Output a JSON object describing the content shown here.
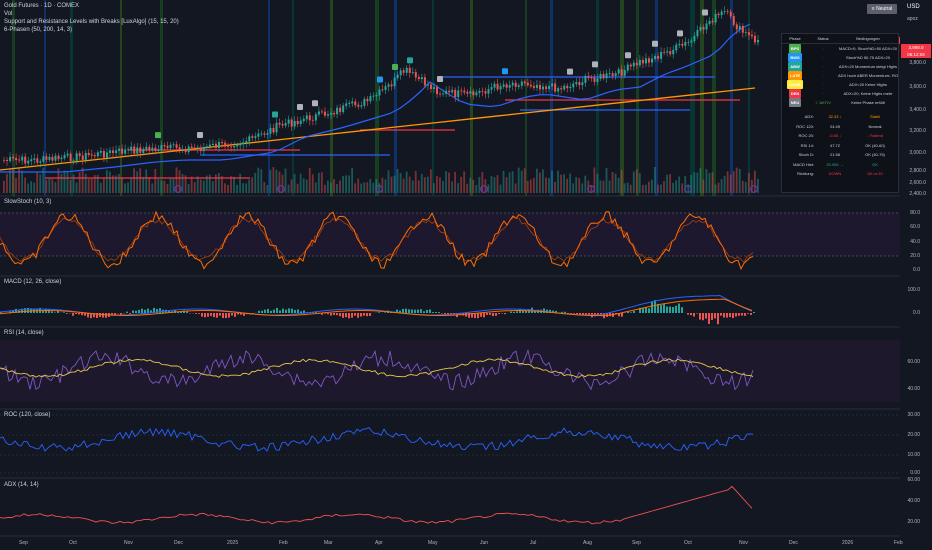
{
  "header": {
    "title": "Gold Futures · 1D · COMEX",
    "vol": "Vol",
    "sr": "Support and Resistance Levels with Breaks [LuxAlgo] (15, 15, 20)",
    "phasen": "6-Phasen (50, 200, 14, 3)"
  },
  "topbar": {
    "neutral": "≡ Neutral",
    "currency": "USD",
    "apoz": "apoz"
  },
  "price_axis": {
    "ticks": [
      "3,800.0",
      "3,600.0",
      "3,400.0",
      "3,200.0",
      "3,000.0",
      "2,800.0",
      "2,600.0",
      "2,400.0",
      "2,200.0"
    ],
    "price_tag_symbol": "GC2025",
    "price_tag_value": "3,998.0",
    "price_tag_time": "06:12:58"
  },
  "phase_table": {
    "headers": [
      "Phase",
      "Status",
      "Bedingungen"
    ],
    "rows": [
      {
        "phase": "BPS",
        "color": "#4caf50",
        "status": "·",
        "cond": "MACD>0; Stoch%D>50 ADX>20"
      },
      {
        "phase": "BWS",
        "color": "#2196f3",
        "status": "·",
        "cond": "Stoch%D 50-75 ADX>20"
      },
      {
        "phase": "ABW",
        "color": "#26a69a",
        "status": "·",
        "cond": "ADX<20 Momentum steigt Highs"
      },
      {
        "phase": "LATE",
        "color": "#ff9800",
        "status": "·",
        "cond": "ADX hoch ABER Momentum↓ ROC↓"
      },
      {
        "phase": "CONS",
        "color": "#ffeb3b",
        "status": "·",
        "cond": "ADX<20 Keine Highs"
      },
      {
        "phase": "DEN",
        "color": "#f23645",
        "status": "·",
        "cond": "ADX<20; Keine Highs mehr"
      },
      {
        "phase": "NEU",
        "color": "#787b86",
        "status": "✓ AKTIV",
        "cond": "Keine Phase erfüllt"
      }
    ],
    "metrics": [
      {
        "label": "ADX:",
        "value": "32.33 ↓",
        "note": "Stabil",
        "color": "#ff9800"
      },
      {
        "label": "ROC 120:",
        "value": "24.49",
        "note": "Normal",
        "color": "#d1d4dc"
      },
      {
        "label": "ROC 20:",
        "value": "-0.88 ↓",
        "note": "↓ Fallend",
        "color": "#f23645"
      },
      {
        "label": "RSI 14:",
        "value": "47.72",
        "note": "OK (40-60)",
        "color": "#d1d4dc"
      },
      {
        "label": "Stoch D:",
        "value": "21.58",
        "note": "OK (40-75)",
        "color": "#d1d4dc"
      },
      {
        "label": "MACD Hist:",
        "value": "25.956 →",
        "note": "OK",
        "color": "#26a69a"
      },
      {
        "label": "Richtung:",
        "value": "DOWN",
        "note": "DIt vs DI",
        "color": "#f23645"
      }
    ]
  },
  "indicators": {
    "stoch": {
      "title": "SlowStoch (10, 3)",
      "ticks": [
        "80.0",
        "60.0",
        "40.0",
        "20.0",
        "0.0"
      ]
    },
    "macd": {
      "title": "MACD (12, 26, close)",
      "ticks": [
        "100.0",
        "0.0"
      ]
    },
    "rsi": {
      "title": "RSI (14, close)",
      "ticks": [
        "60.00",
        "40.00"
      ]
    },
    "roc": {
      "title": "ROC (120, close)",
      "ticks": [
        "30.00",
        "20.00",
        "10.00",
        "0.00"
      ]
    },
    "adx": {
      "title": "ADX (14, 14)",
      "ticks": [
        "60.00",
        "40.00",
        "20.00"
      ]
    }
  },
  "x_axis": [
    "Sep",
    "Oct",
    "Nov",
    "Dec",
    "2025",
    "Feb",
    "Mar",
    "Apr",
    "May",
    "Jun",
    "Jul",
    "Aug",
    "Sep",
    "Oct",
    "Nov",
    "Dec",
    "2026",
    "Feb"
  ],
  "colors": {
    "bg": "#131722",
    "up": "#26a69a",
    "down": "#ef5350",
    "orange": "#ff9800",
    "blue": "#2962ff",
    "stoch": "#ff6d00"
  }
}
